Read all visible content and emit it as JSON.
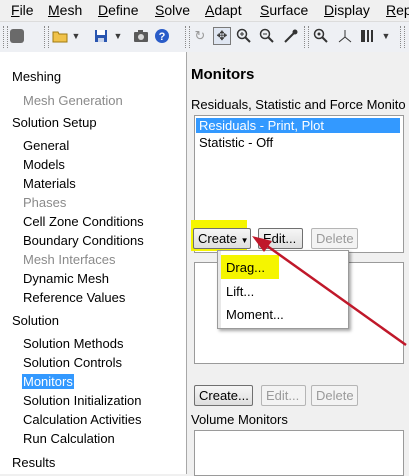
{
  "menubar": {
    "items": [
      "File",
      "Mesh",
      "Define",
      "Solve",
      "Adapt",
      "Surface",
      "Display",
      "Rep"
    ]
  },
  "toolbar": {
    "icons": [
      "save-state-icon",
      "open-folder-icon",
      "save-icon",
      "camera-icon",
      "help-icon",
      "rotate-icon",
      "pan-icon",
      "zoom-in-icon",
      "zoom-box-icon",
      "probe-icon",
      "fit-view-icon",
      "axes-icon",
      "layout-icon"
    ]
  },
  "nav": {
    "sections": [
      {
        "label": "Meshing",
        "children": [
          {
            "label": "Mesh Generation",
            "disabled": true
          }
        ]
      },
      {
        "label": "Solution Setup",
        "children": [
          {
            "label": "General"
          },
          {
            "label": "Models"
          },
          {
            "label": "Materials"
          },
          {
            "label": "Phases",
            "disabled": true
          },
          {
            "label": "Cell Zone Conditions"
          },
          {
            "label": "Boundary Conditions"
          },
          {
            "label": "Mesh Interfaces",
            "disabled": true
          },
          {
            "label": "Dynamic Mesh"
          },
          {
            "label": "Reference Values"
          }
        ]
      },
      {
        "label": "Solution",
        "children": [
          {
            "label": "Solution Methods"
          },
          {
            "label": "Solution Controls"
          },
          {
            "label": "Monitors",
            "selected": true
          },
          {
            "label": "Solution Initialization"
          },
          {
            "label": "Calculation Activities"
          },
          {
            "label": "Run Calculation"
          }
        ]
      },
      {
        "label": "Results",
        "children": []
      }
    ]
  },
  "monitors": {
    "title": "Monitors",
    "residuals_section_label": "Residuals, Statistic and Force Monito",
    "list_items": [
      "Residuals - Print, Plot",
      "Statistic - Off"
    ],
    "create_label": "Create",
    "edit_label": "Edit...",
    "delete_label": "Delete",
    "dropdown_items": [
      "Drag...",
      "Lift...",
      "Moment..."
    ],
    "second_create_label": "Create...",
    "second_edit_label": "Edit...",
    "second_delete_label": "Delete",
    "volume_monitors_label": "Volume Monitors"
  },
  "colors": {
    "selection": "#3399ff",
    "highlight": "#f5f500",
    "arrow": "#c0182a"
  }
}
